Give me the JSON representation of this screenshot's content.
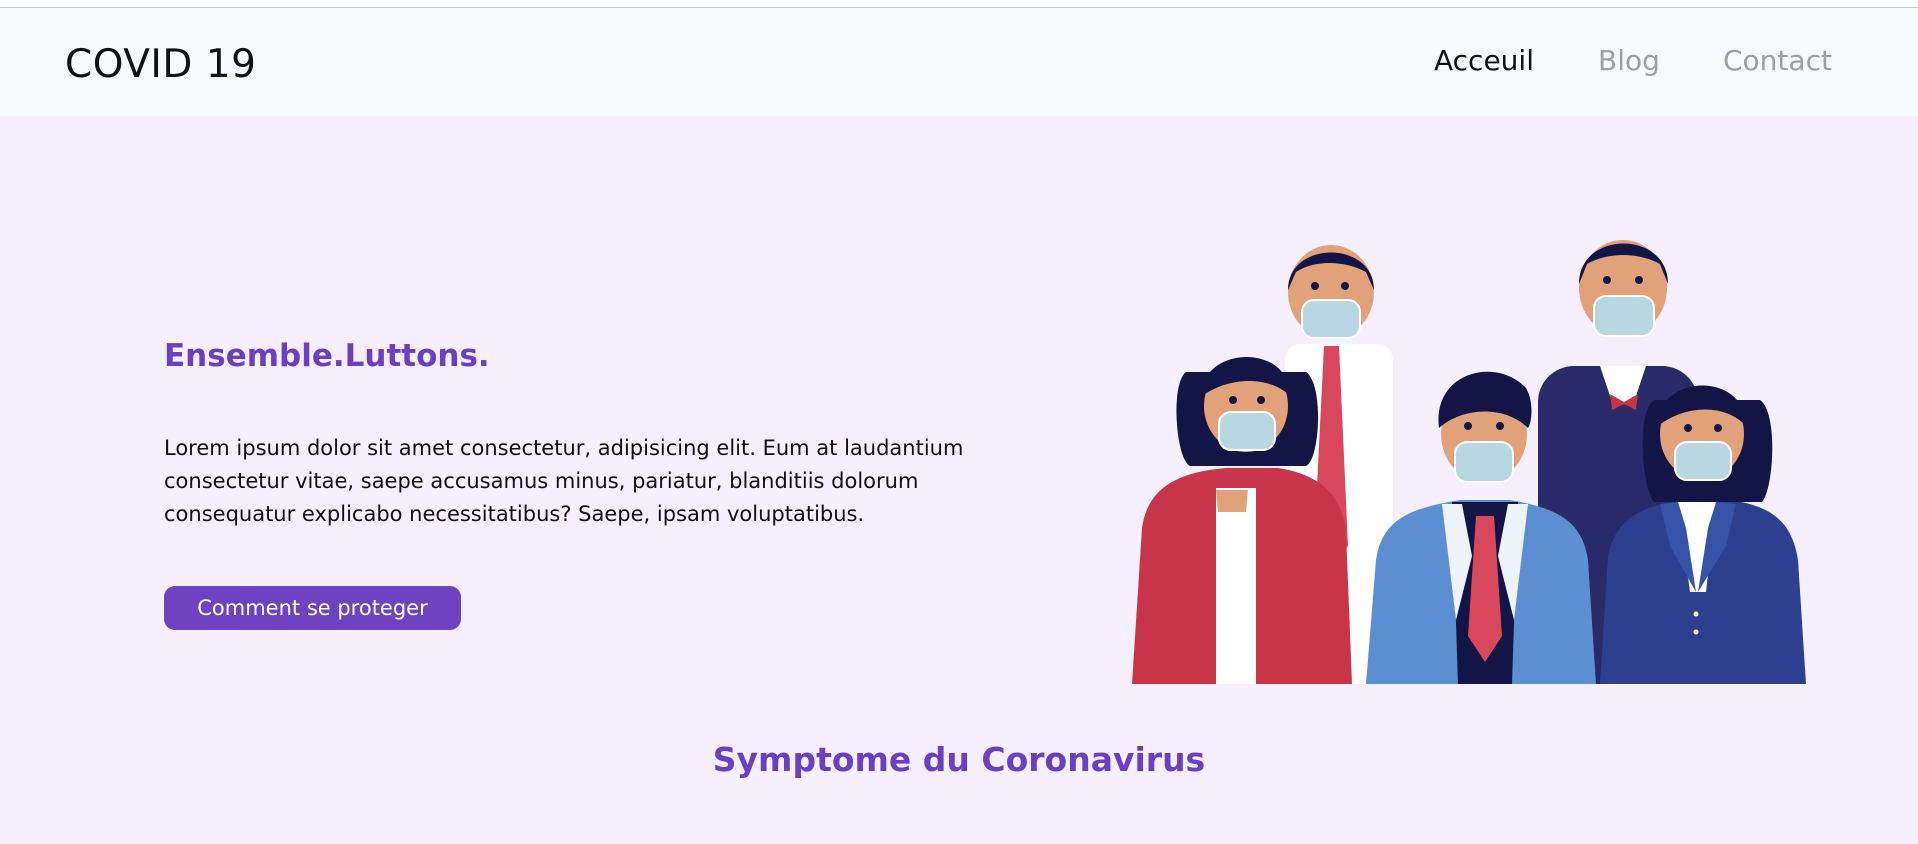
{
  "navbar": {
    "brand": "COVID 19",
    "links": [
      {
        "label": "Acceuil",
        "active": true
      },
      {
        "label": "Blog",
        "active": false
      },
      {
        "label": "Contact",
        "active": false
      }
    ]
  },
  "hero": {
    "title": "Ensemble.Luttons.",
    "text": "Lorem ipsum dolor sit amet consectetur, adipisicing elit. Eum at laudantium consectetur vitae, saepe accusamus minus, pariatur, blanditiis dolorum consequatur explicabo necessitatibus? Saepe, ipsam voluptatibus.",
    "button_label": "Comment se proteger",
    "illustration": "people-wearing-masks-illustration"
  },
  "section": {
    "title": "Symptome du Coronavirus"
  },
  "colors": {
    "accent": "#6f42c1",
    "hero_bg": "#f6efff",
    "nav_bg": "#f8f9fb",
    "nav_inactive": "#9aa0a6"
  }
}
